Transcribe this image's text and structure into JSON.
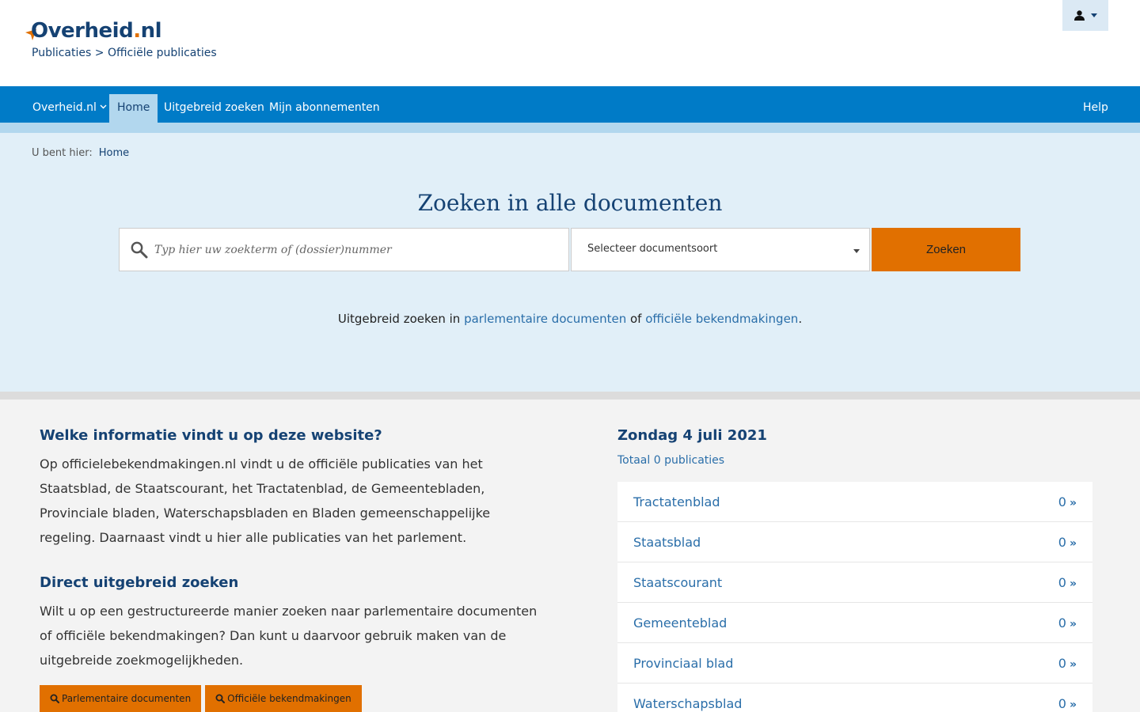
{
  "header": {
    "logo_text": "Overheid",
    "logo_dot": ".",
    "logo_tld": "nl",
    "breadcrumb": [
      "Publicaties",
      ">",
      "Officiële publicaties"
    ],
    "user_icon": "user-icon"
  },
  "nav": {
    "items": [
      {
        "label": "Overheid.nl",
        "has_caret": true
      },
      {
        "label": "Home",
        "active": true
      },
      {
        "label": "Uitgebreid zoeken"
      },
      {
        "label": "Mijn abonnementen"
      }
    ],
    "help": "Help"
  },
  "hero": {
    "you_are_here": "U bent hier:",
    "crumb_home": "Home",
    "title": "Zoeken in alle documenten",
    "search_placeholder": "Typ hier uw zoekterm of (dossier)nummer",
    "select_label": "Selecteer documentsoort",
    "search_button": "Zoeken",
    "links_prefix": "Uitgebreid zoeken in",
    "link_parlementair": "parlementaire documenten",
    "links_of": "of",
    "link_bekendmakingen": "officiële bekendmakingen",
    "links_suffix": "."
  },
  "info": {
    "heading": "Welke informatie vindt u op deze website?",
    "text": "Op officielebekendmakingen.nl vindt u de officiële publicaties van het Staatsblad, de Staatscourant, het Tractatenblad, de Gemeentebladen, Provinciale bladen, Waterschapsbladen en Bladen gemeenschappelijke regeling. Daarnaast vindt u hier alle publicaties van het parlement.",
    "heading2": "Direct uitgebreid zoeken",
    "text2": "Wilt u op een gestructureerde manier zoeken naar parlementaire documenten of officiële bekendmakingen? Dan kunt u daarvoor gebruik maken van de uitgebreide zoekmogelijkheden.",
    "button1": "Parlementaire documenten",
    "button2": "Officiële bekendmakingen"
  },
  "today": {
    "date": "Zondag 4 juli 2021",
    "total": "Totaal 0 publicaties",
    "publications": [
      {
        "name": "Tractatenblad",
        "count": "0"
      },
      {
        "name": "Staatsblad",
        "count": "0"
      },
      {
        "name": "Staatscourant",
        "count": "0"
      },
      {
        "name": "Gemeenteblad",
        "count": "0"
      },
      {
        "name": "Provinciaal blad",
        "count": "0"
      },
      {
        "name": "Waterschapsblad",
        "count": "0"
      }
    ]
  },
  "colors": {
    "brand_blue": "#154273",
    "nav_blue": "#007bc7",
    "accent_orange": "#e17000",
    "link_blue": "#2a6ea9",
    "hero_bg": "#e1eff8"
  }
}
